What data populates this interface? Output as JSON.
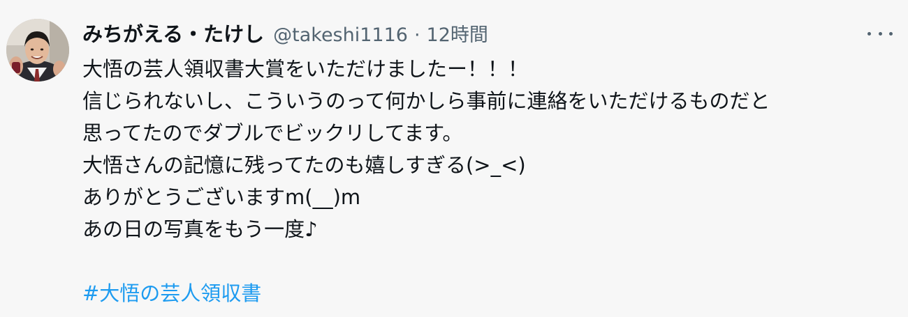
{
  "tweet": {
    "author": {
      "display_name": "みちがえる・たけし",
      "handle": "@takeshi1116",
      "separator": "·",
      "timestamp": "12時間"
    },
    "avatar_icon": "profile-photo",
    "more_icon": "more-horizontal-icon",
    "lines": [
      "大悟の芸人領収書大賞をいただけましたー！！！",
      "信じられないし、こういうのって何かしら事前に連絡をいただけるものだと",
      "思ってたのでダブルでビックリしてます。",
      "大悟さんの記憶に残ってたのも嬉しすぎる(>_<)",
      "ありがとうございますm(__)m",
      "あの日の写真をもう一度♪"
    ],
    "hashtag": "#大悟の芸人領収書",
    "colors": {
      "background": "#f7f7f7",
      "text": "#0f1419",
      "secondary": "#536471",
      "link": "#1d9bf0"
    }
  }
}
